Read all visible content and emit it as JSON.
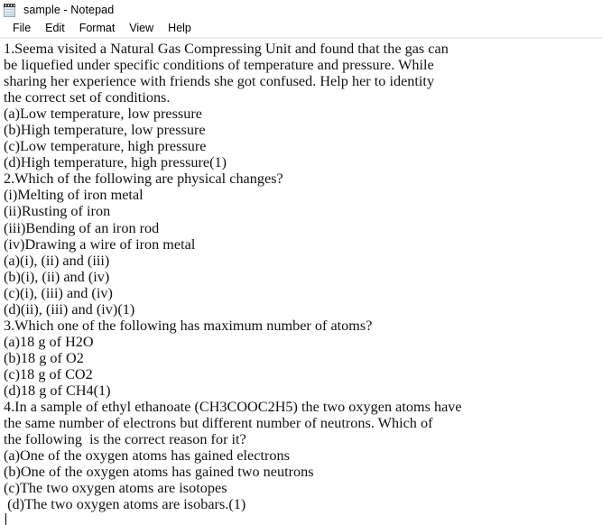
{
  "window": {
    "title": "sample - Notepad",
    "icon": "notepad-icon",
    "background_color": "#ffffff",
    "text_color": "#111111"
  },
  "menu": {
    "items": [
      {
        "label": "File"
      },
      {
        "label": "Edit"
      },
      {
        "label": "Format"
      },
      {
        "label": "View"
      },
      {
        "label": "Help"
      }
    ]
  },
  "document": {
    "lines": [
      "1.Seema visited a Natural Gas Compressing Unit and found that the gas can",
      "be liquefied under specific conditions of temperature and pressure. While",
      "sharing her experience with friends she got confused. Help her to identity",
      "the correct set of conditions.",
      "(a)Low temperature, low pressure",
      "(b)High temperature, low pressure",
      "(c)Low temperature, high pressure",
      "(d)High temperature, high pressure(1)",
      "2.Which of the following are physical changes?",
      "(i)Melting of iron metal",
      "(ii)Rusting of iron",
      "(iii)Bending of an iron rod",
      "(iv)Drawing a wire of iron metal",
      "(a)(i), (ii) and (iii)",
      "(b)(i), (ii) and (iv)",
      "(c)(i), (iii) and (iv)",
      "(d)(ii), (iii) and (iv)(1)",
      "3.Which one of the following has maximum number of atoms?",
      "(a)18 g of H2O",
      "(b)18 g of O2",
      "(c)18 g of CO2",
      "(d)18 g of CH4(1)",
      "4.In a sample of ethyl ethanoate (CH3COOC2H5) the two oxygen atoms have",
      "the same number of electrons but different number of neutrons. Which of",
      "the following  is the correct reason for it?",
      "(a)One of the oxygen atoms has gained electrons",
      "(b)One of the oxygen atoms has gained two neutrons",
      "(c)The two oxygen atoms are isotopes",
      " (d)The two oxygen atoms are isobars.(1)"
    ]
  }
}
